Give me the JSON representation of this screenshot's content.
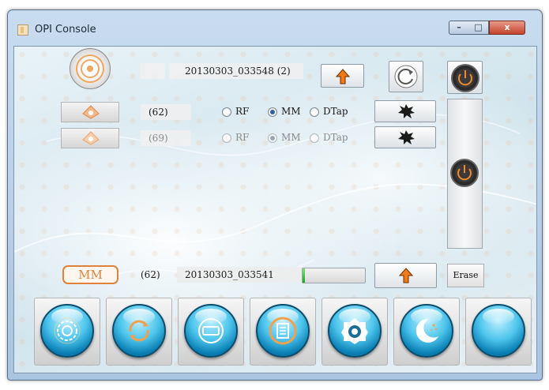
{
  "window": {
    "title": "OPI Console",
    "controls": {
      "minimize": "–",
      "maximize": "□",
      "close": "x"
    }
  },
  "top": {
    "session_label": "20130303_033548 (2)"
  },
  "channels": [
    {
      "count": "(62)",
      "options": [
        "RF",
        "MM",
        "DTap"
      ],
      "selected": "MM",
      "enabled": true
    },
    {
      "count": "(69)",
      "options": [
        "RF",
        "MM",
        "DTap"
      ],
      "selected": "MM",
      "enabled": false
    }
  ],
  "status_row": {
    "mode_badge": "MM",
    "count": "(62)",
    "session_label": "20130303_033541",
    "progress": 0.04,
    "erase_label": "Erase"
  },
  "colors": {
    "accent_orange": "#e0823a",
    "orb_blue": "#1ea6da",
    "progress_green": "#23a323"
  },
  "bottom_toolbar": {
    "icons": [
      "settings-gear-icon",
      "sync-cycle-icon",
      "display-icon",
      "document-icon",
      "camera-aperture-icon",
      "moon-sleep-icon",
      "blank-orb-icon"
    ]
  }
}
